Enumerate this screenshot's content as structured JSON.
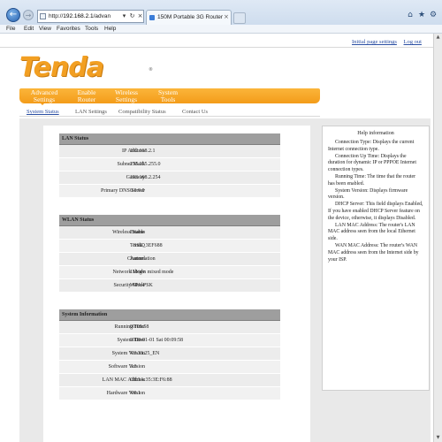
{
  "browser": {
    "address_prefix": "http://",
    "address_domain": "192.168.2.1",
    "address_path": "/advan",
    "tab_title": "150M Portable 3G Router",
    "menu": [
      "File",
      "Edit",
      "View",
      "Favorites",
      "Tools",
      "Help"
    ]
  },
  "header": {
    "links": [
      "Initial page settings",
      "Log out"
    ],
    "logo": "Tenda"
  },
  "nav": {
    "items": [
      {
        "line1": "Advanced",
        "line2": "Settings"
      },
      {
        "line1": "Enable",
        "line2": "Router"
      },
      {
        "line1": "Wireless",
        "line2": "Settings"
      },
      {
        "line1": "System",
        "line2": "Tools"
      }
    ],
    "subtabs": [
      "System Status",
      "LAN Settings",
      "Compatibility Status",
      "Contact Us"
    ]
  },
  "sections": [
    {
      "title": "LAN Status",
      "rows": [
        {
          "label": "IP Address",
          "value": "192.168.2.1"
        },
        {
          "label": "Subnet Mask",
          "value": "255.255.255.0"
        },
        {
          "label": "Gateway",
          "value": "192.168.2.254"
        },
        {
          "label": "Primary DNS Server",
          "value": "0.0.0.0"
        }
      ]
    },
    {
      "title": "WLAN Status",
      "rows": [
        {
          "label": "Wireless Status",
          "value": "Enable"
        },
        {
          "label": "SSID",
          "value": "Tenda_3EF688"
        },
        {
          "label": "Channel",
          "value": "Automation"
        },
        {
          "label": "Network Mode",
          "value": "11b/g/n mixed mode"
        },
        {
          "label": "Security Mode",
          "value": "WPA-PSK"
        }
      ]
    },
    {
      "title": "System Information",
      "rows": [
        {
          "label": "Running Time",
          "value": "00:09:58"
        },
        {
          "label": "System Time",
          "value": "2000-01-01 Sat 00:09:58"
        },
        {
          "label": "System Version",
          "value": "V3.33.25_EN"
        },
        {
          "label": "Software Version",
          "value": "3.3"
        },
        {
          "label": "LAN MAC Address",
          "value": "C8:3A:35:3E:F6:88"
        },
        {
          "label": "Hardware Version",
          "value": "V0.1"
        }
      ]
    }
  ],
  "help": {
    "title": "Help information",
    "paragraphs": [
      "Connection Type: Displays the current Internet connection type.",
      "Connection Up Time: Displays the duration for dynamic IP or PPPOE Internet connection types.",
      "Running Time: The time that the router has been enabled.",
      "System Version: Displays firmware version.",
      "DHCP Server: This field displays Enabled, If you have enabled DHCP Server feature on the device, otherwise, it displays Disabled.",
      "LAN MAC Address: The router's LAN MAC address seen from the local Ethernet side.",
      "WAN MAC Address: The router's WAN MAC address seen from the Internet side by your ISP."
    ]
  }
}
